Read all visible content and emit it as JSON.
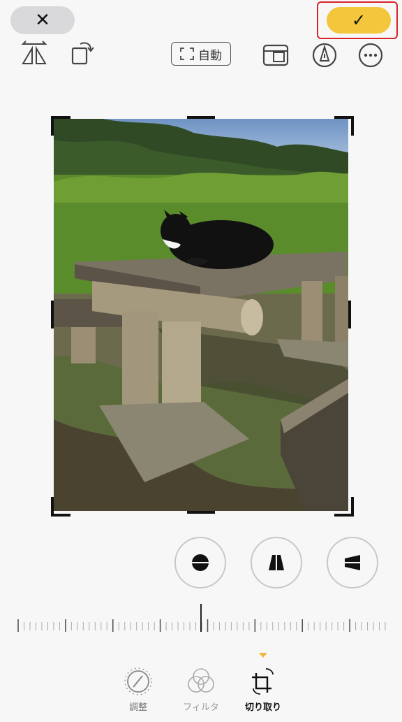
{
  "toolbar": {
    "cancel_label": "✕",
    "done_label": "✓",
    "auto_label": "自動",
    "icons": [
      "flip-horizontal-icon",
      "rotate-icon",
      "auto-straighten-icon",
      "aspect-ratio-icon",
      "markup-icon",
      "more-icon"
    ]
  },
  "perspective_buttons": [
    "horizon-straighten-icon",
    "vertical-perspective-icon",
    "horizontal-perspective-icon"
  ],
  "tabs": [
    {
      "label": "調整",
      "icon": "adjust-dial-icon",
      "selected": false
    },
    {
      "label": "フィルタ",
      "icon": "filters-icon",
      "selected": false
    },
    {
      "label": "切り取り",
      "icon": "crop-icon",
      "selected": true
    }
  ],
  "colors": {
    "accent": "#f3c63c",
    "selected_tab_indicator": "#f3b53c",
    "highlight_box": "#d8232a",
    "background": "#f7f7f7"
  }
}
